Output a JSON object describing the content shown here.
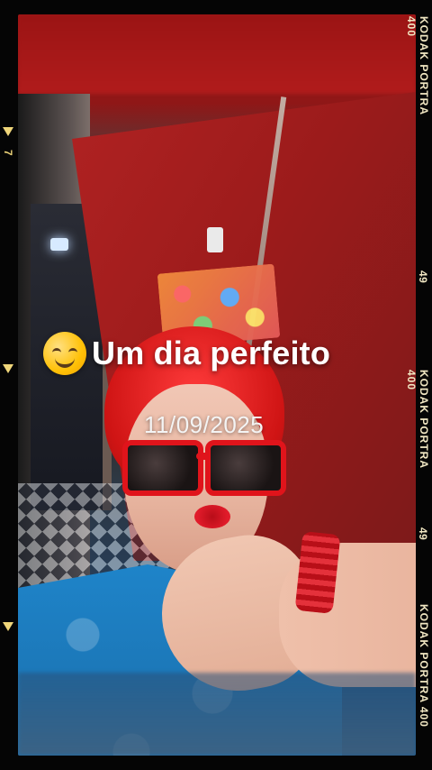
{
  "overlay": {
    "title": "Um dia perfeito",
    "date": "11/09/2025",
    "emoji_icon": "smiling-face-icon"
  },
  "film": {
    "right_labels": [
      "KODAK PORTRA 400",
      "KODAK PORTRA 400",
      "KODAK PORTRA 400"
    ],
    "right_numbers": [
      "49",
      "49"
    ],
    "left_marks": [
      "7"
    ]
  }
}
